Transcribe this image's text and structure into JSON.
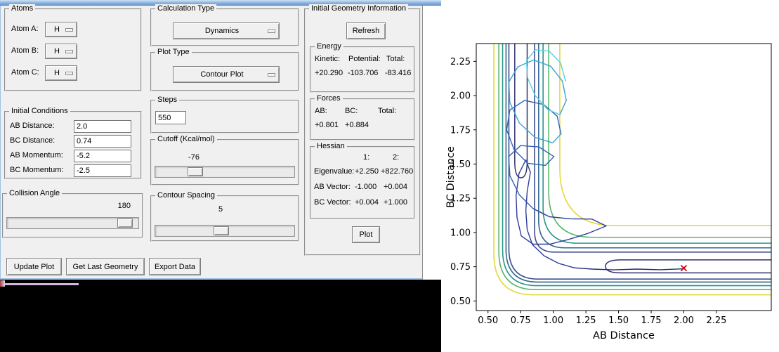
{
  "form": {
    "atoms": {
      "title": "Atoms",
      "rows": [
        {
          "label": "Atom A:",
          "value": "H"
        },
        {
          "label": "Atom B:",
          "value": "H"
        },
        {
          "label": "Atom C:",
          "value": "H"
        }
      ]
    },
    "calculation_type": {
      "title": "Calculation Type",
      "selected": "Dynamics"
    },
    "plot_type": {
      "title": "Plot Type",
      "selected": "Contour Plot"
    },
    "initial_geometry": {
      "title": "Initial Geometry Information",
      "refresh_label": "Refresh",
      "energy": {
        "title": "Energy",
        "headers": [
          "Kinetic:",
          "Potential:",
          "Total:"
        ],
        "values": [
          "+20.290",
          "-103.706",
          "-83.416"
        ]
      },
      "forces": {
        "title": "Forces",
        "headers": [
          "AB:",
          "BC:",
          "Total:"
        ],
        "values": [
          "+0.801",
          "+0.884",
          ""
        ]
      },
      "hessian": {
        "title": "Hessian",
        "col_headers": [
          "1:",
          "2:"
        ],
        "rows": [
          {
            "label": "Eigenvalue:",
            "v1": "+2.250",
            "v2": "+822.760"
          },
          {
            "label": "AB Vector:",
            "v1": "-1.000",
            "v2": "+0.004"
          },
          {
            "label": "BC Vector:",
            "v1": "+0.004",
            "v2": "+1.000"
          }
        ]
      },
      "plot_label": "Plot"
    },
    "initial_conditions": {
      "title": "Initial Conditions",
      "rows": [
        {
          "label": "AB Distance:",
          "value": "2.0"
        },
        {
          "label": "BC Distance:",
          "value": "0.74"
        },
        {
          "label": "AB Momentum:",
          "value": "-5.2"
        },
        {
          "label": "BC Momentum:",
          "value": "-2.5"
        }
      ]
    },
    "steps": {
      "title": "Steps",
      "value": "550"
    },
    "cutoff": {
      "title": "Cutoff (Kcal/mol)",
      "value": "-76"
    },
    "collision_angle": {
      "title": "Collision Angle",
      "value": "180"
    },
    "contour_spacing": {
      "title": "Contour Spacing",
      "value": "5"
    },
    "buttons": {
      "update_plot": "Update Plot",
      "get_last_geometry": "Get Last Geometry",
      "export_data": "Export Data"
    }
  },
  "chart_data": {
    "type": "contour",
    "title": "",
    "xlabel": "AB Distance",
    "ylabel": "BC Distance",
    "xlim": [
      0.41,
      2.67
    ],
    "ylim": [
      0.43,
      2.38
    ],
    "xticks": [
      0.5,
      0.75,
      1.0,
      1.25,
      1.5,
      1.75,
      2.0,
      2.25
    ],
    "xtick_labels": [
      "0.50",
      "0.75",
      "1.00",
      "1.25",
      "1.50",
      "1.75",
      "2.00",
      "2.25"
    ],
    "yticks": [
      0.5,
      0.75,
      1.0,
      1.25,
      1.5,
      1.75,
      2.0,
      2.25
    ],
    "ytick_labels": [
      "0.50",
      "0.75",
      "1.00",
      "1.25",
      "1.50",
      "1.75",
      "2.00",
      "2.25"
    ],
    "grid": false,
    "legend": "none",
    "description": "L-shaped potential energy surface contours (valley arms along AB=0.74 and BC=0.74) with a reactive dynamics trajectory starting at the red x marker (2.0, 0.74).",
    "contour_levels": [
      {
        "color": "#e5d93a",
        "outer": 0.545,
        "outer_r": 0.3,
        "inner": 1.05,
        "inner_r": 0.42
      },
      {
        "color": "#58b668",
        "outer": 0.583,
        "outer_r": 0.28,
        "inner": 0.965,
        "inner_r": 0.33
      },
      {
        "color": "#27968b",
        "outer": 0.612,
        "outer_r": 0.26,
        "inner": 0.922,
        "inner_r": 0.26
      },
      {
        "color": "#31688e",
        "outer": 0.638,
        "outer_r": 0.24,
        "inner": 0.888,
        "inner_r": 0.2
      },
      {
        "color": "#3e4d8d",
        "outer": 0.66,
        "outer_r": 0.22,
        "inner": 0.857,
        "inner_r": 0.15
      }
    ],
    "valley_hairpin": {
      "color": "#30306f",
      "lo": 0.705,
      "hi": 0.8,
      "turn": 1.4
    },
    "trajectory": {
      "points": [
        [
          2.0,
          0.735
        ],
        [
          1.82,
          0.728
        ],
        [
          1.64,
          0.733
        ],
        [
          1.46,
          0.727
        ],
        [
          1.3,
          0.733
        ],
        [
          1.16,
          0.742
        ],
        [
          1.04,
          0.775
        ],
        [
          0.93,
          0.83
        ],
        [
          0.84,
          0.912
        ],
        [
          0.8,
          1.02
        ],
        [
          0.79,
          1.16
        ],
        [
          0.8,
          1.3
        ],
        [
          0.825,
          1.44
        ],
        [
          0.79,
          1.53
        ],
        [
          0.737,
          1.43
        ],
        [
          0.715,
          1.27
        ],
        [
          0.722,
          1.11
        ],
        [
          0.755,
          0.975
        ],
        [
          0.845,
          0.915
        ],
        [
          0.975,
          0.915
        ],
        [
          1.12,
          0.95
        ],
        [
          1.27,
          0.995
        ],
        [
          1.405,
          1.048
        ],
        [
          1.295,
          1.098
        ],
        [
          1.13,
          1.1
        ],
        [
          0.97,
          1.115
        ],
        [
          0.845,
          1.175
        ],
        [
          0.74,
          1.275
        ],
        [
          0.668,
          1.415
        ],
        [
          0.658,
          1.555
        ],
        [
          0.75,
          1.635
        ],
        [
          0.89,
          1.625
        ],
        [
          1.005,
          1.555
        ],
        [
          0.94,
          1.49
        ],
        [
          0.805,
          1.505
        ],
        [
          0.7,
          1.605
        ],
        [
          0.643,
          1.75
        ],
        [
          0.668,
          1.895
        ],
        [
          0.78,
          1.965
        ],
        [
          0.925,
          1.935
        ],
        [
          1.03,
          1.85
        ],
        [
          1.06,
          1.72
        ],
        [
          0.995,
          1.655
        ],
        [
          0.86,
          1.695
        ],
        [
          0.74,
          1.8
        ],
        [
          0.667,
          1.95
        ],
        [
          0.66,
          2.1
        ],
        [
          0.728,
          2.21
        ],
        [
          0.85,
          2.26
        ],
        [
          0.98,
          2.215
        ],
        [
          1.07,
          2.105
        ],
        [
          1.1,
          1.965
        ],
        [
          1.05,
          1.86
        ],
        [
          0.955,
          1.9
        ],
        [
          0.862,
          2.0
        ],
        [
          0.803,
          2.13
        ],
        [
          0.795,
          2.255
        ],
        [
          0.862,
          2.335
        ],
        [
          0.968,
          2.325
        ],
        [
          1.055,
          2.24
        ],
        [
          1.095,
          2.105
        ]
      ],
      "segments": [
        {
          "upto": 6,
          "color": "#1e2a80"
        },
        {
          "upto": 27,
          "color": "#2c3e9c"
        },
        {
          "upto": 42,
          "color": "#2f62b8"
        },
        {
          "upto": 53,
          "color": "#38a0d8"
        },
        {
          "upto": 61,
          "color": "#55cde6"
        }
      ]
    },
    "marker": {
      "x": 2.0,
      "y": 0.74,
      "symbol": "x",
      "color": "#dd0000"
    }
  }
}
